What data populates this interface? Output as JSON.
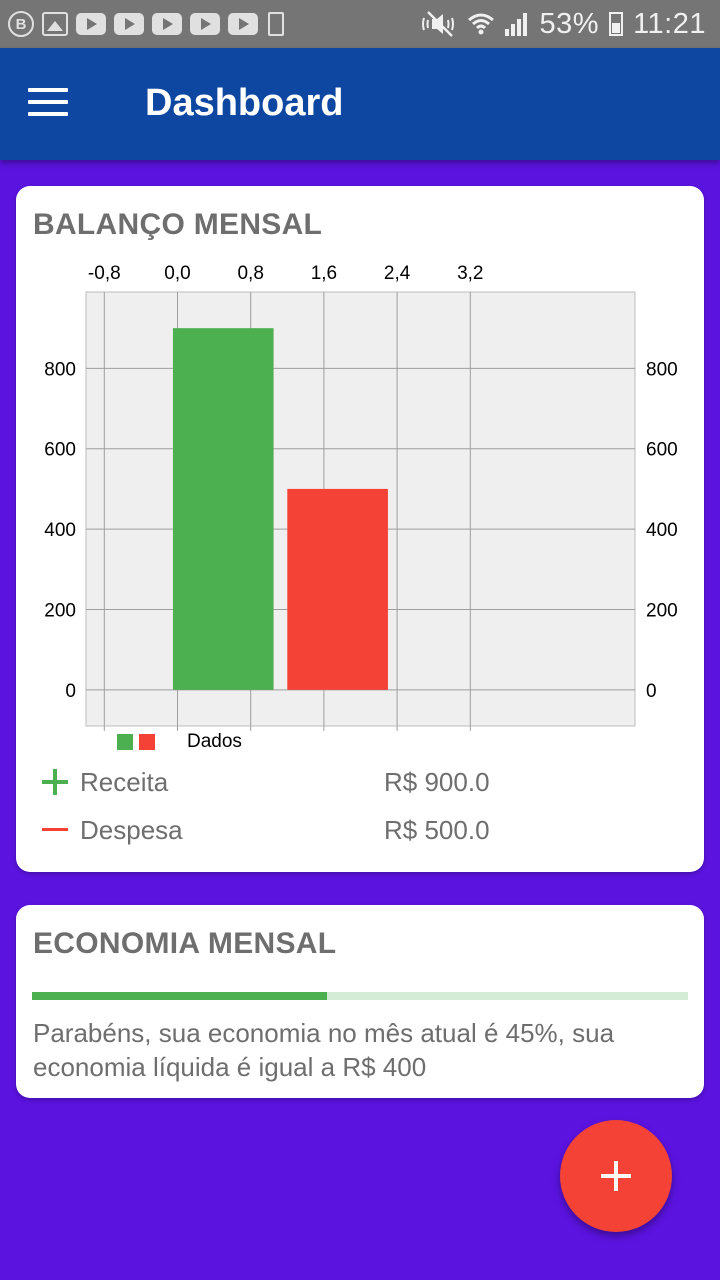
{
  "status_bar": {
    "battery": "53%",
    "time": "11:21",
    "left_icons": [
      "b-icon",
      "gallery-icon",
      "youtube-icon",
      "youtube-icon",
      "youtube-icon",
      "youtube-icon",
      "youtube-icon",
      "battery-saver-icon"
    ],
    "b_letter": "B"
  },
  "app_bar": {
    "title": "Dashboard",
    "menu_icon": "menu-icon"
  },
  "balance_card": {
    "title": "BALANÇO MENSAL",
    "chart_data": {
      "type": "bar",
      "title": "",
      "x_ticks": [
        "-0,8",
        "0,0",
        "0,8",
        "1,6",
        "2,4",
        "3,2"
      ],
      "y_ticks_left": [
        "0",
        "200",
        "400",
        "600",
        "800"
      ],
      "y_ticks_right": [
        "0",
        "200",
        "400",
        "600",
        "800"
      ],
      "ylim": [
        -90,
        990
      ],
      "xlim": [
        -1.0,
        5.0
      ],
      "series": [
        {
          "name": "Dados",
          "x": 0.5,
          "value": 900,
          "color": "#4caf50"
        },
        {
          "name": "Dados",
          "x": 1.75,
          "value": 500,
          "color": "#f44336"
        }
      ],
      "bar_width": 1.1,
      "grid": true,
      "legend": {
        "label": "Dados",
        "colors": [
          "#4caf50",
          "#f44336"
        ],
        "placement": "bottom-left"
      }
    },
    "rows": [
      {
        "icon": "plus-icon",
        "label": "Receita",
        "value": "R$ 900.0",
        "color": "#4caf50"
      },
      {
        "icon": "minus-icon",
        "label": "Despesa",
        "value": "R$ 500.0",
        "color": "#f44336"
      }
    ]
  },
  "economy_card": {
    "title": "ECONOMIA MENSAL",
    "progress_percent": 45,
    "message": "Parabéns, sua economia no mês atual é 45%, sua economia líquida é igual a R$ 400"
  },
  "fab": {
    "icon": "plus-icon"
  },
  "colors": {
    "background": "#5b13e0",
    "app_bar": "#0d47a1",
    "receita": "#4caf50",
    "despesa": "#f44336",
    "fab": "#f44336"
  }
}
